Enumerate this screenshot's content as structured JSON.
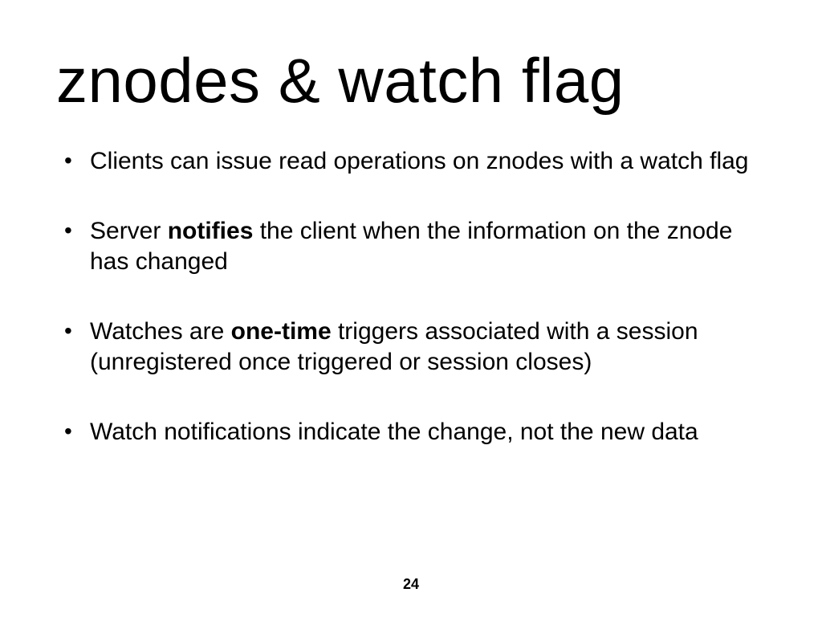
{
  "slide": {
    "title": "znodes & watch flag",
    "bullets": [
      {
        "pre": "Clients can issue read operations on znodes with a watch flag",
        "bold": "",
        "post": ""
      },
      {
        "pre": "Server ",
        "bold": "notifies",
        "post": " the client when the information on the znode has changed"
      },
      {
        "pre": "Watches are ",
        "bold": "one-time",
        "post": " triggers associated with a session (unregistered once triggered or session closes)"
      },
      {
        "pre": "Watch notifications indicate the change, not the new data",
        "bold": "",
        "post": ""
      }
    ],
    "page_number": "24"
  }
}
